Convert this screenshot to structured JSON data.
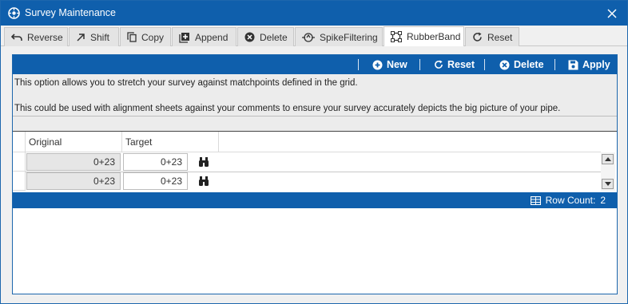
{
  "window": {
    "title": "Survey Maintenance"
  },
  "tabs": [
    {
      "label": "Reverse",
      "icon": "undo-icon"
    },
    {
      "label": "Shift",
      "icon": "arrow-up-right-icon"
    },
    {
      "label": "Copy",
      "icon": "copy-icon"
    },
    {
      "label": "Append",
      "icon": "add-box-icon"
    },
    {
      "label": "Delete",
      "icon": "delete-circle-icon"
    },
    {
      "label": "SpikeFiltering",
      "icon": "spike-filter-icon"
    },
    {
      "label": "RubberBand",
      "icon": "rubberband-icon",
      "active": true
    },
    {
      "label": "Reset",
      "icon": "refresh-icon"
    }
  ],
  "toolbar": {
    "new_label": "New",
    "reset_label": "Reset",
    "delete_label": "Delete",
    "apply_label": "Apply"
  },
  "info": {
    "line1": "This option allows you to stretch your survey against matchpoints defined in the grid.",
    "line2": "This could be used with alignment sheets against your comments to ensure your survey accurately depicts the big picture of your pipe."
  },
  "grid": {
    "columns": [
      "Original",
      "Target"
    ],
    "rows": [
      {
        "original": "0+23",
        "target": "0+23"
      },
      {
        "original": "0+23",
        "target": "0+23"
      }
    ]
  },
  "status": {
    "row_count_label": "Row Count:",
    "row_count": "2"
  },
  "colors": {
    "accent": "#0f5fac",
    "panel_bg": "#ececec",
    "readonly_cell": "#e6e6e6"
  }
}
